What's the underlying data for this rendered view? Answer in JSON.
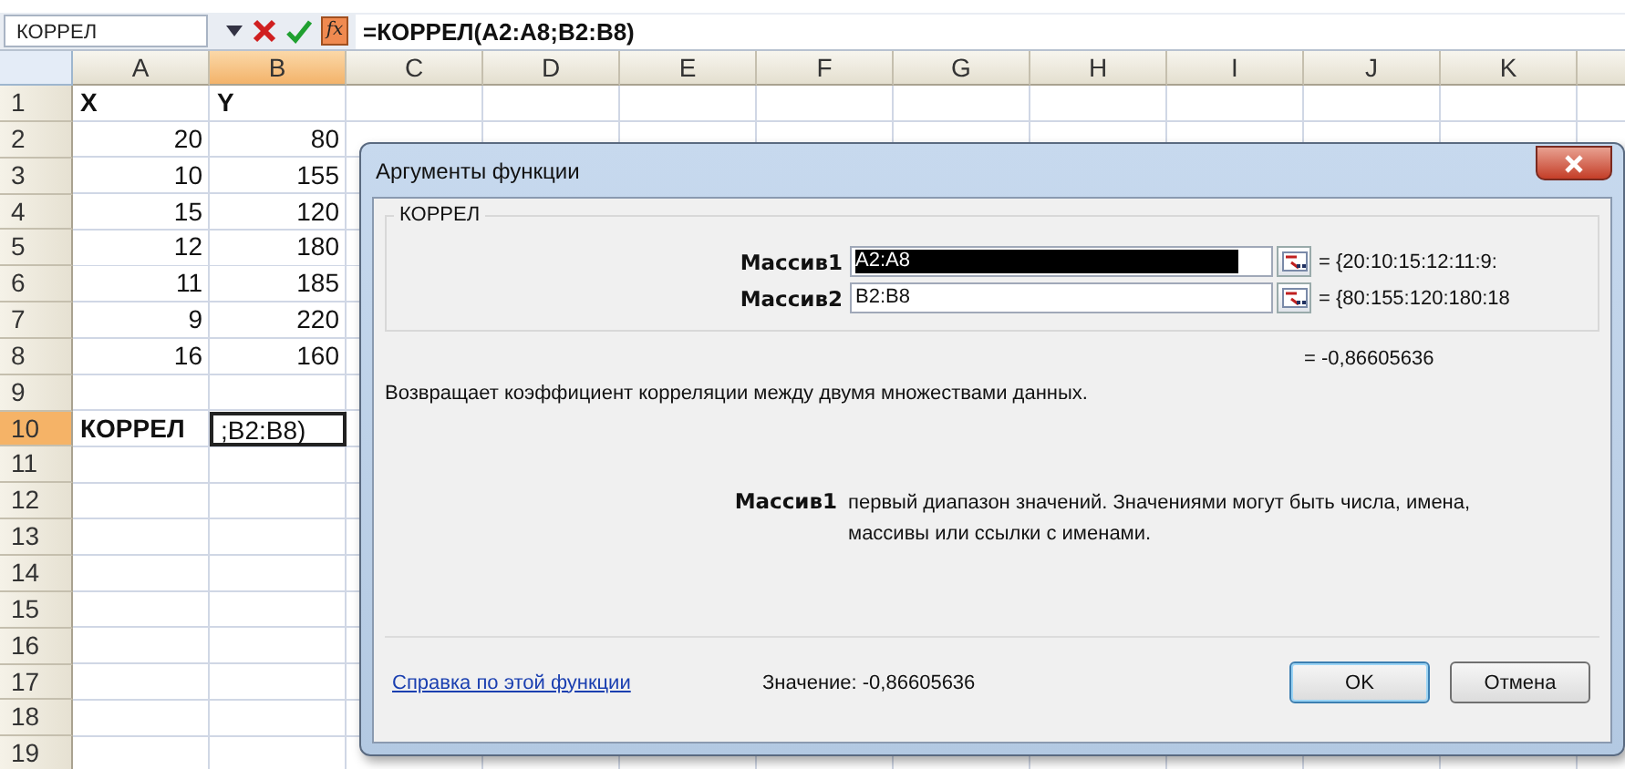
{
  "name_box": "КОРРЕЛ",
  "formula_bar": {
    "fx_label": "fx",
    "formula": "=КОРРЕЛ(A2:A8;B2:B8)"
  },
  "columns": [
    {
      "label": "A",
      "selected": false
    },
    {
      "label": "B",
      "selected": true
    },
    {
      "label": "C",
      "selected": false
    },
    {
      "label": "D",
      "selected": false
    },
    {
      "label": "E",
      "selected": false
    },
    {
      "label": "F",
      "selected": false
    },
    {
      "label": "G",
      "selected": false
    },
    {
      "label": "H",
      "selected": false
    },
    {
      "label": "I",
      "selected": false
    },
    {
      "label": "J",
      "selected": false
    },
    {
      "label": "K",
      "selected": false
    }
  ],
  "rows": [
    {
      "label": "1",
      "selected": false,
      "cells": [
        {
          "text": "X",
          "kind": "header"
        },
        {
          "text": "Y",
          "kind": "header"
        }
      ]
    },
    {
      "label": "2",
      "selected": false,
      "cells": [
        {
          "text": "20",
          "kind": "number"
        },
        {
          "text": "80",
          "kind": "number"
        }
      ]
    },
    {
      "label": "3",
      "selected": false,
      "cells": [
        {
          "text": "10",
          "kind": "number"
        },
        {
          "text": "155",
          "kind": "number"
        }
      ]
    },
    {
      "label": "4",
      "selected": false,
      "cells": [
        {
          "text": "15",
          "kind": "number"
        },
        {
          "text": "120",
          "kind": "number"
        }
      ]
    },
    {
      "label": "5",
      "selected": false,
      "cells": [
        {
          "text": "12",
          "kind": "number"
        },
        {
          "text": "180",
          "kind": "number"
        }
      ]
    },
    {
      "label": "6",
      "selected": false,
      "cells": [
        {
          "text": "11",
          "kind": "number"
        },
        {
          "text": "185",
          "kind": "number"
        }
      ]
    },
    {
      "label": "7",
      "selected": false,
      "cells": [
        {
          "text": "9",
          "kind": "number"
        },
        {
          "text": "220",
          "kind": "number"
        }
      ]
    },
    {
      "label": "8",
      "selected": false,
      "cells": [
        {
          "text": "16",
          "kind": "number"
        },
        {
          "text": "160",
          "kind": "number"
        }
      ]
    },
    {
      "label": "9",
      "selected": false,
      "cells": []
    },
    {
      "label": "10",
      "selected": true,
      "cells": [
        {
          "text": "КОРРЕЛ",
          "kind": "header"
        },
        {
          "text": ";B2:B8)",
          "kind": "editing"
        }
      ]
    },
    {
      "label": "11",
      "selected": false,
      "cells": []
    },
    {
      "label": "12",
      "selected": false,
      "cells": []
    },
    {
      "label": "13",
      "selected": false,
      "cells": []
    },
    {
      "label": "14",
      "selected": false,
      "cells": []
    },
    {
      "label": "15",
      "selected": false,
      "cells": []
    },
    {
      "label": "16",
      "selected": false,
      "cells": []
    },
    {
      "label": "17",
      "selected": false,
      "cells": []
    },
    {
      "label": "18",
      "selected": false,
      "cells": []
    },
    {
      "label": "19",
      "selected": false,
      "cells": []
    }
  ],
  "dialog": {
    "title": "Аргументы функции",
    "function_name": "КОРРЕЛ",
    "arguments": [
      {
        "label": "Массив1",
        "value": "A2:A8",
        "result": "= {20:10:15:12:11:9:",
        "selected": true
      },
      {
        "label": "Массив2",
        "value": "B2:B8",
        "result": "= {80:155:120:180:18",
        "selected": false
      }
    ],
    "result": "= -0,86605636",
    "description": "Возвращает коэффициент корреляции между двумя множествами данных.",
    "argument_help": {
      "label": "Массив1",
      "text": "первый диапазон значений. Значениями могут быть числа, имена, массивы или ссылки с именами."
    },
    "help_link": "Справка по этой функции",
    "value_text": "Значение: -0,86605636",
    "buttons": [
      {
        "label": "OK",
        "default": true
      },
      {
        "label": "Отмена",
        "default": false
      }
    ]
  }
}
